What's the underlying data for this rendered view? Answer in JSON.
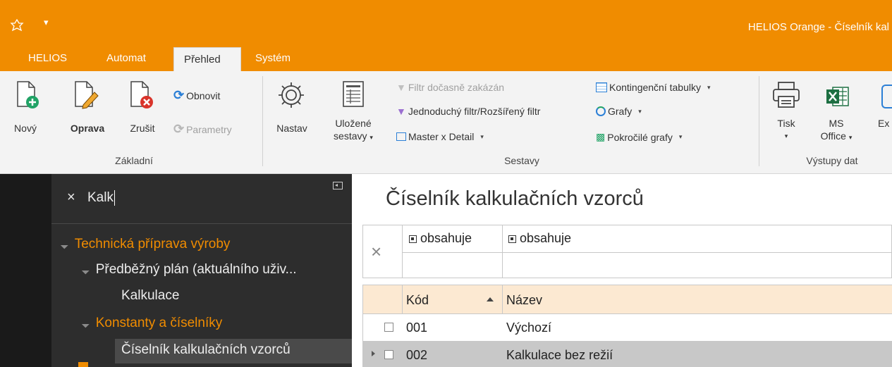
{
  "window": {
    "title": "HELIOS Orange - Číselník kal"
  },
  "colors": {
    "accent": "#F08C00",
    "nav_bg": "#2D2D2D",
    "row_selected": "#C8C8C8",
    "header_bg": "#FCE9D2"
  },
  "tabs": [
    {
      "label": "HELIOS"
    },
    {
      "label": "Automat"
    },
    {
      "label": "Přehled",
      "active": true
    },
    {
      "label": "Systém"
    }
  ],
  "ribbon": {
    "zakladni": {
      "label": "Základní",
      "novy": "Nový",
      "oprava": "Oprava",
      "zrusit": "Zrušit",
      "obnovit": "Obnovit",
      "parametry": "Parametry"
    },
    "sestavy": {
      "label": "Sestavy",
      "nastav": "Nastav",
      "ulozene_line1": "Uložené",
      "ulozene_line2": "sestavy",
      "filtr_zakazan": "Filtr dočasně zakázán",
      "jednoduchy_filtr": "Jednoduchý filtr/Rozšířený filtr",
      "master_detail": "Master x Detail",
      "kontingencni": "Kontingenční tabulky",
      "grafy": "Grafy",
      "pokrocile_grafy": "Pokročilé grafy"
    },
    "vystupy": {
      "label": "Výstupy dat",
      "tisk": "Tisk",
      "ms_line1": "MS",
      "ms_line2": "Office",
      "ex": "Ex"
    }
  },
  "nav": {
    "search_value": "Kalk",
    "tree": [
      {
        "label": "Technická příprava výroby"
      },
      {
        "label": "Předběžný plán (aktuálního uživ..."
      },
      {
        "label": "Kalkulace"
      },
      {
        "label": "Konstanty a číselníky"
      },
      {
        "label": "Číselník kalkulačních vzorců"
      }
    ]
  },
  "content": {
    "title": "Číselník kalkulačních vzorců",
    "filter_row": {
      "col1": "obsahuje",
      "col2": "obsahuje"
    },
    "columns": [
      {
        "label": "Kód"
      },
      {
        "label": "Název"
      }
    ],
    "rows": [
      {
        "kod": "001",
        "nazev": "Výchozí"
      },
      {
        "kod": "002",
        "nazev": "Kalkulace bez režií"
      }
    ]
  }
}
